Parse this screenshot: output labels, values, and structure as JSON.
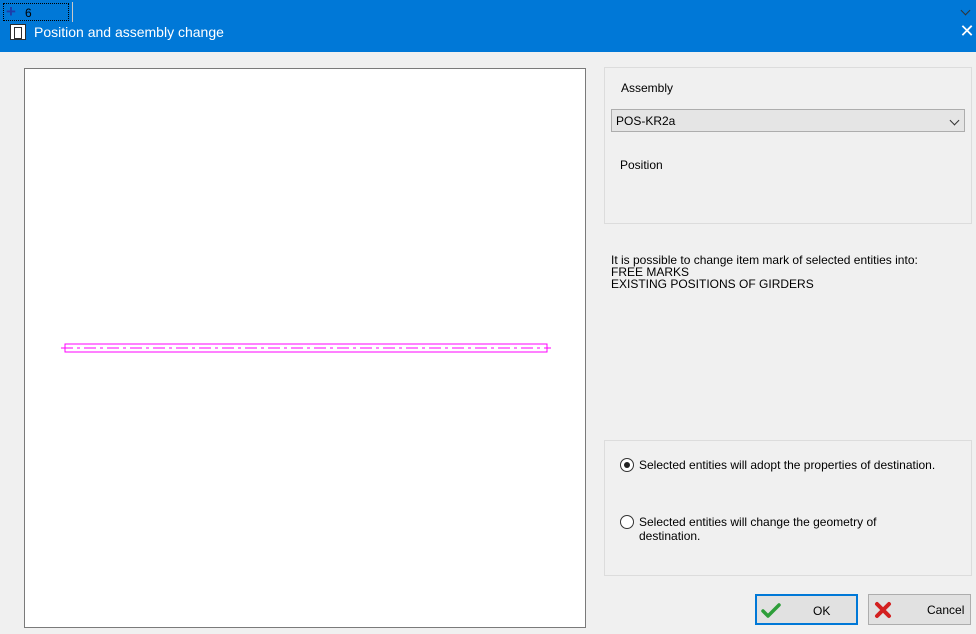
{
  "window": {
    "title": "Position and assembly change",
    "close_glyph": "✕"
  },
  "assembly": {
    "label": "Assembly",
    "value": "POS-KR2a"
  },
  "position": {
    "label": "Position",
    "value": "6",
    "icon": "plus-icon"
  },
  "info": {
    "line1": "It is possible to change item mark of selected entities into:",
    "line2": "FREE MARKS",
    "line3": "EXISTING POSITIONS OF GIRDERS"
  },
  "options": {
    "adopt_properties": {
      "label": "Selected entities will adopt the properties of destination.",
      "checked": true
    },
    "change_geometry": {
      "label": "Selected entities will change the geometry of destination.",
      "checked": false
    }
  },
  "buttons": {
    "ok": "OK",
    "cancel": "Cancel"
  },
  "colors": {
    "titlebar": "#0078d7",
    "preview_beam": "#ff00ff",
    "ok_check": "#2e9e3a",
    "cancel_x": "#d32020"
  }
}
